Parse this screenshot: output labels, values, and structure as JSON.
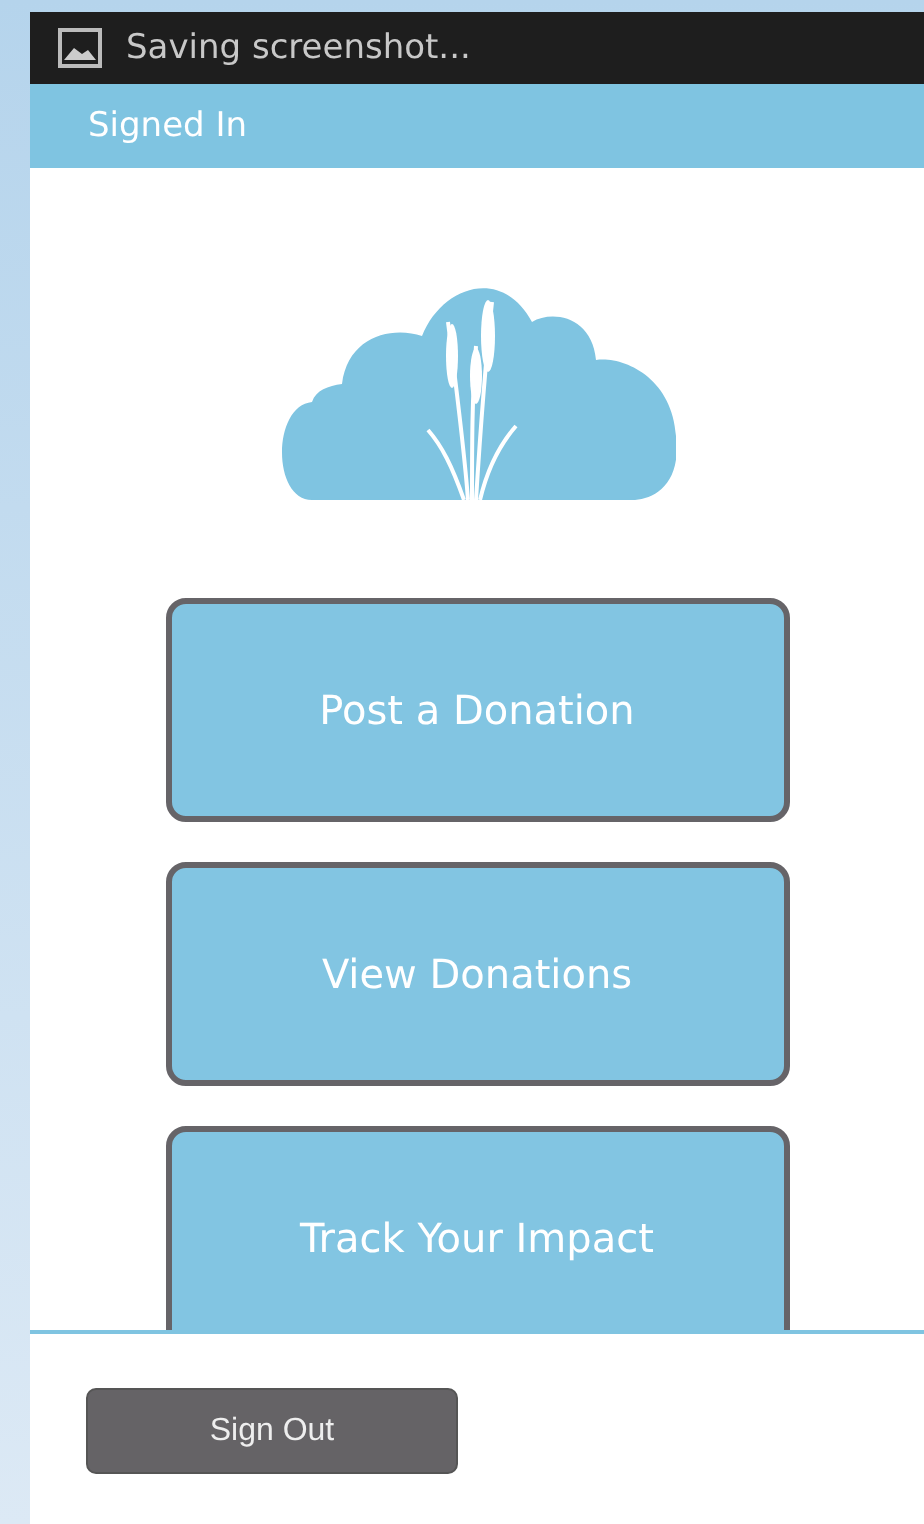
{
  "notification": {
    "text": "Saving screenshot..."
  },
  "title_bar": {
    "title": "Signed In"
  },
  "menu_buttons": [
    {
      "label": "Post a Donation"
    },
    {
      "label": "View Donations"
    },
    {
      "label": "Track Your Impact"
    }
  ],
  "footer": {
    "sign_out": "Sign Out"
  }
}
